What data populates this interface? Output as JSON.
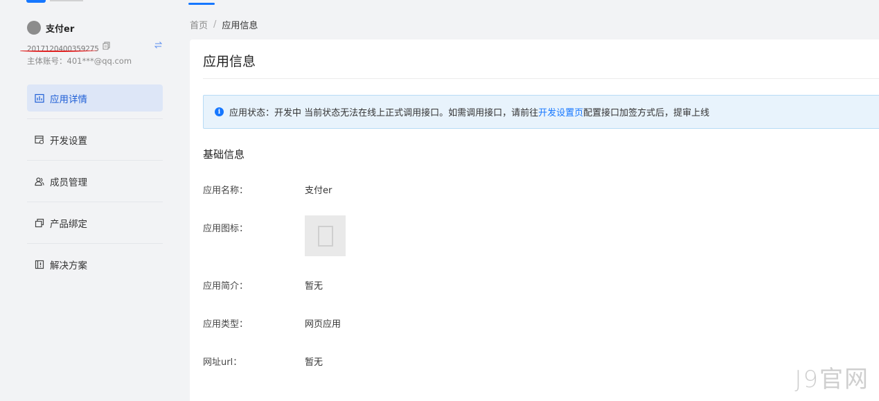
{
  "sidebar": {
    "app_name": "支付er",
    "app_id": "2017120400359275",
    "account": "主体账号：401***@qq.com",
    "items": [
      {
        "label": "应用详情",
        "icon": "chart-icon",
        "active": true
      },
      {
        "label": "开发设置",
        "icon": "dev-settings-icon",
        "active": false
      },
      {
        "label": "成员管理",
        "icon": "members-icon",
        "active": false
      },
      {
        "label": "产品绑定",
        "icon": "product-bind-icon",
        "active": false
      },
      {
        "label": "解决方案",
        "icon": "solution-icon",
        "active": false
      }
    ]
  },
  "breadcrumb": {
    "home": "首页",
    "separator": "/",
    "current": "应用信息"
  },
  "card": {
    "title": "应用信息",
    "alert": {
      "prefix": "应用状态：开发中 当前状态无法在线上正式调用接口。如需调用接口，请前往",
      "link": "开发设置页",
      "suffix": "配置接口加签方式后，提审上线"
    },
    "section_title": "基础信息",
    "fields": [
      {
        "label": "应用名称：",
        "value": "支付er"
      },
      {
        "label": "应用图标：",
        "value": ""
      },
      {
        "label": "应用简介：",
        "value": "暂无"
      },
      {
        "label": "应用类型：",
        "value": "网页应用"
      },
      {
        "label": "网址url：",
        "value": "暂无"
      }
    ]
  },
  "watermark": "J9官网",
  "colors": {
    "accent": "#1677ff",
    "active_bg": "#dde6f7",
    "annotation": "#e02020"
  }
}
